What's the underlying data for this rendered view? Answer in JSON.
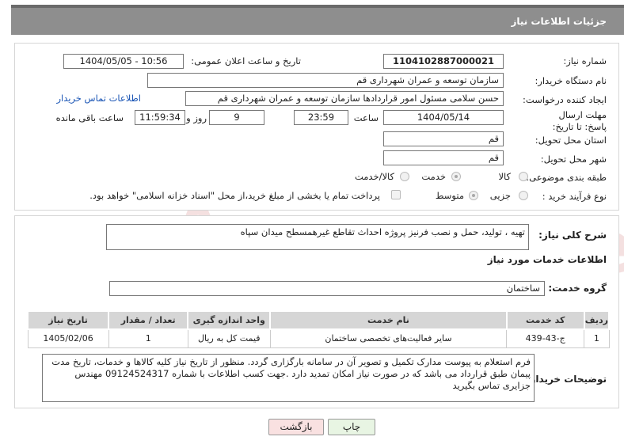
{
  "header": {
    "title": "جزئیات اطلاعات نیاز"
  },
  "fields": {
    "need_number": {
      "label": "شماره نیاز:",
      "value": "1104102887000021"
    },
    "announce_datetime": {
      "label": "تاریخ و ساعت اعلان عمومی:",
      "value": "1404/05/05 - 10:56"
    },
    "buyer_org": {
      "label": "نام دستگاه خریدار:",
      "value": "سازمان توسعه و عمران شهرداری قم"
    },
    "requester": {
      "label": "ایجاد کننده درخواست:",
      "value": "حسن سلامی مسئول امور قراردادها سازمان توسعه و عمران شهرداری قم"
    },
    "buyer_contact_link": "اطلاعات تماس خریدار",
    "deadline": {
      "label": "مهلت ارسال پاسخ: تا تاریخ:",
      "date": "1404/05/14",
      "time_label": "ساعت",
      "time": "23:59",
      "days": "9",
      "days_label": "روز و",
      "remaining": "11:59:34",
      "remaining_label": "ساعت باقی مانده"
    },
    "delivery_province": {
      "label": "استان محل تحویل:",
      "value": "قم"
    },
    "delivery_city": {
      "label": "شهر محل تحویل:",
      "value": "قم"
    },
    "category": {
      "label": "طبقه بندی موضوعی:",
      "options": [
        "کالا",
        "خدمت",
        "کالا/خدمت"
      ],
      "selected": "خدمت"
    },
    "process_type": {
      "label": "نوع فرآیند خرید :",
      "options": [
        "جزیی",
        "متوسط"
      ],
      "selected": "متوسط",
      "payment_note": "پرداخت تمام یا بخشی از مبلغ خرید،از محل \"اسناد خزانه اسلامی\" خواهد بود."
    }
  },
  "summary": {
    "label": "شرح کلی نیاز:",
    "value": "تهیه ، تولید، حمل و نصب فرنیز پروژه احداث تقاطع غیرهمسطح میدان سپاه"
  },
  "services": {
    "section_title": "اطلاعات خدمات مورد نیاز",
    "group_label": "گروه خدمت:",
    "group_value": "ساختمان",
    "columns": [
      "ردیف",
      "کد خدمت",
      "نام خدمت",
      "واحد اندازه گیری",
      "تعداد / مقدار",
      "تاریخ نیاز"
    ],
    "rows": [
      [
        "1",
        "ج-43-439",
        "سایر فعالیت‌های تخصصی ساختمان",
        "قیمت کل به ریال",
        "1",
        "1405/02/06"
      ]
    ]
  },
  "buyer_notes": {
    "label": "توضیحات خریدار:",
    "value": "فرم استعلام به پیوست مدارک تکمیل و تصویر آن در سامانه بارگزاری گردد. منظور از تاریخ نیاز کلیه کالاها و خدمات، تاریخ مدت پیمان طبق قرارداد می باشد که در صورت نیاز امکان تمدید دارد .جهت کسب اطلاعات با شماره 09124524317 مهندس جزایری تماس بگیرید"
  },
  "buttons": {
    "print": "چاپ",
    "back": "بازگشت"
  },
  "watermark": "AriaTender.neT",
  "colors": {
    "header_bg": "#8e8e8e",
    "link": "#1a55b5",
    "print_btn": "#e8f5e3",
    "back_btn": "#f9e1e1"
  }
}
